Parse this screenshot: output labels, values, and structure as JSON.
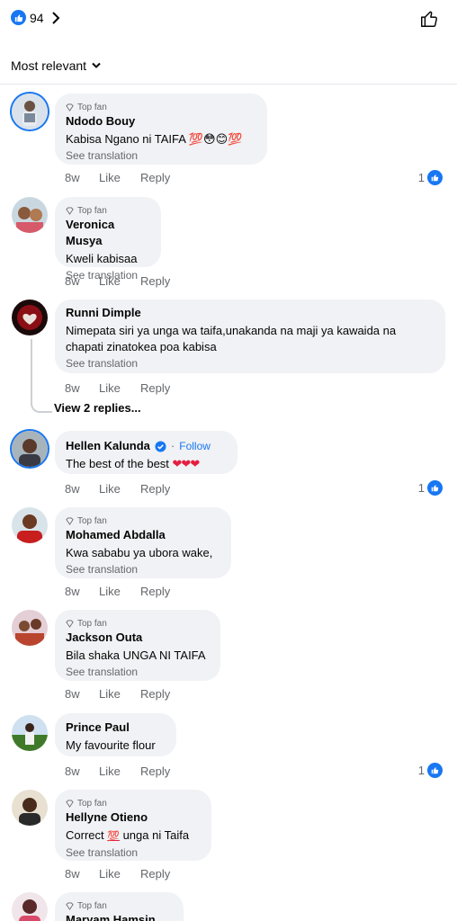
{
  "header": {
    "like_count": "94",
    "sort_label": "Most relevant"
  },
  "labels": {
    "top_fan": "Top fan",
    "see_translation": "See translation",
    "like": "Like",
    "reply": "Reply",
    "follow": "Follow",
    "dot": "·"
  },
  "comments": [
    {
      "name": "Ndodo Bouy",
      "text": "Kabisa Ngano ni TAIFA 💯😳😊💯",
      "time": "8w",
      "reactions": "1"
    },
    {
      "name": "Veronica Musya",
      "text": "Kweli kabisaa",
      "time": "8w"
    },
    {
      "name": "Runni Dimple",
      "text_line1": "Nimepata siri ya unga wa taifa,unakanda na maji ya kawaida na",
      "text_line2": "chapati zinatokea poa kabisa",
      "time": "8w",
      "view_replies": "View 2 replies..."
    },
    {
      "name": "Hellen Kalunda",
      "text": "The best of the best",
      "hearts": "❤❤❤",
      "time": "8w",
      "reactions": "1"
    },
    {
      "name": "Mohamed Abdalla",
      "text": "Kwa sababu ya ubora wake,",
      "time": "8w"
    },
    {
      "name": "Jackson Outa",
      "text": "Bila shaka UNGA NI TAIFA",
      "time": "8w"
    },
    {
      "name": "Prince Paul",
      "text": "My favourite flour",
      "time": "8w",
      "reactions": "1"
    },
    {
      "name": "Hellyne Otieno",
      "text_pre": "Correct",
      "hundred": "💯",
      "text_post": "unga ni Taifa",
      "time": "8w"
    },
    {
      "name": "Maryam Hamsin"
    }
  ]
}
